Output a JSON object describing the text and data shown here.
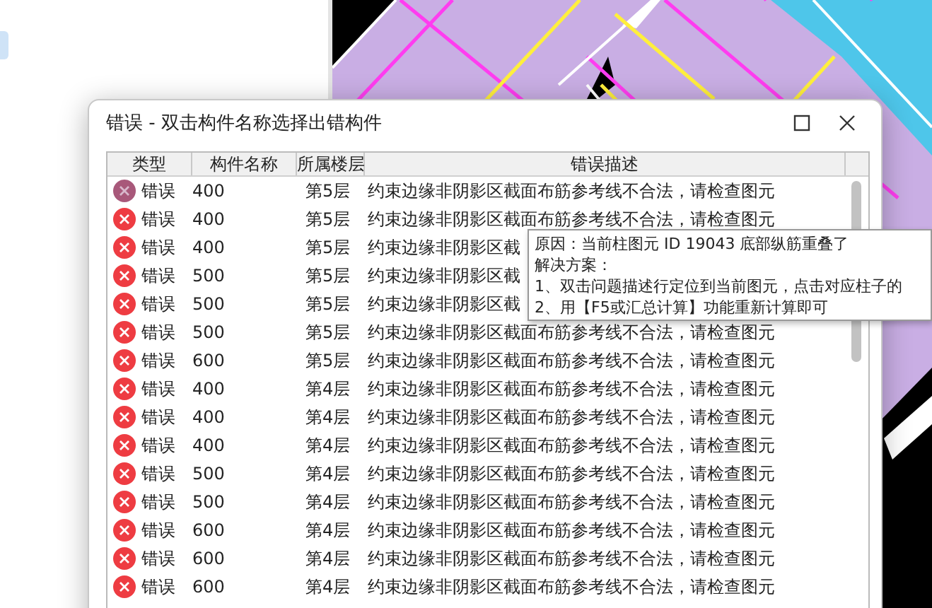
{
  "dialog": {
    "title": "错误 - 双击构件名称选择出错构件"
  },
  "table": {
    "columns": [
      "类型",
      "构件名称",
      "所属楼层",
      "错误描述"
    ],
    "rows": [
      {
        "type": "错误",
        "name": "400",
        "floor": "第5层",
        "description": "约束边缘非阴影区截面布筋参考线不合法，请检查图元",
        "selected": true
      },
      {
        "type": "错误",
        "name": "400",
        "floor": "第5层",
        "description": "约束边缘非阴影区截面布筋参考线不合法，请检查图元",
        "selected": false
      },
      {
        "type": "错误",
        "name": "400",
        "floor": "第5层",
        "description": "约束边缘非阴影区截",
        "selected": false
      },
      {
        "type": "错误",
        "name": "500",
        "floor": "第5层",
        "description": "约束边缘非阴影区截",
        "selected": false
      },
      {
        "type": "错误",
        "name": "500",
        "floor": "第5层",
        "description": "约束边缘非阴影区截",
        "selected": false
      },
      {
        "type": "错误",
        "name": "500",
        "floor": "第5层",
        "description": "约束边缘非阴影区截面布筋参考线不合法，请检查图元",
        "selected": false
      },
      {
        "type": "错误",
        "name": "600",
        "floor": "第5层",
        "description": "约束边缘非阴影区截面布筋参考线不合法，请检查图元",
        "selected": false
      },
      {
        "type": "错误",
        "name": "400",
        "floor": "第4层",
        "description": "约束边缘非阴影区截面布筋参考线不合法，请检查图元",
        "selected": false
      },
      {
        "type": "错误",
        "name": "400",
        "floor": "第4层",
        "description": "约束边缘非阴影区截面布筋参考线不合法，请检查图元",
        "selected": false
      },
      {
        "type": "错误",
        "name": "400",
        "floor": "第4层",
        "description": "约束边缘非阴影区截面布筋参考线不合法，请检查图元",
        "selected": false
      },
      {
        "type": "错误",
        "name": "500",
        "floor": "第4层",
        "description": "约束边缘非阴影区截面布筋参考线不合法，请检查图元",
        "selected": false
      },
      {
        "type": "错误",
        "name": "500",
        "floor": "第4层",
        "description": "约束边缘非阴影区截面布筋参考线不合法，请检查图元",
        "selected": false
      },
      {
        "type": "错误",
        "name": "600",
        "floor": "第4层",
        "description": "约束边缘非阴影区截面布筋参考线不合法，请检查图元",
        "selected": false
      },
      {
        "type": "错误",
        "name": "600",
        "floor": "第4层",
        "description": "约束边缘非阴影区截面布筋参考线不合法，请检查图元",
        "selected": false
      },
      {
        "type": "错误",
        "name": "600",
        "floor": "第4层",
        "description": "约束边缘非阴影区截面布筋参考线不合法，请检查图元",
        "selected": false
      }
    ]
  },
  "tooltip": {
    "lines": [
      "原因：当前柱图元 ID 19043 底部纵筋重叠了",
      "解决方案：",
      "1、双击问题描述行定位到当前图元，点击对应柱子的",
      "2、用【F5或汇总计算】功能重新计算即可"
    ]
  }
}
